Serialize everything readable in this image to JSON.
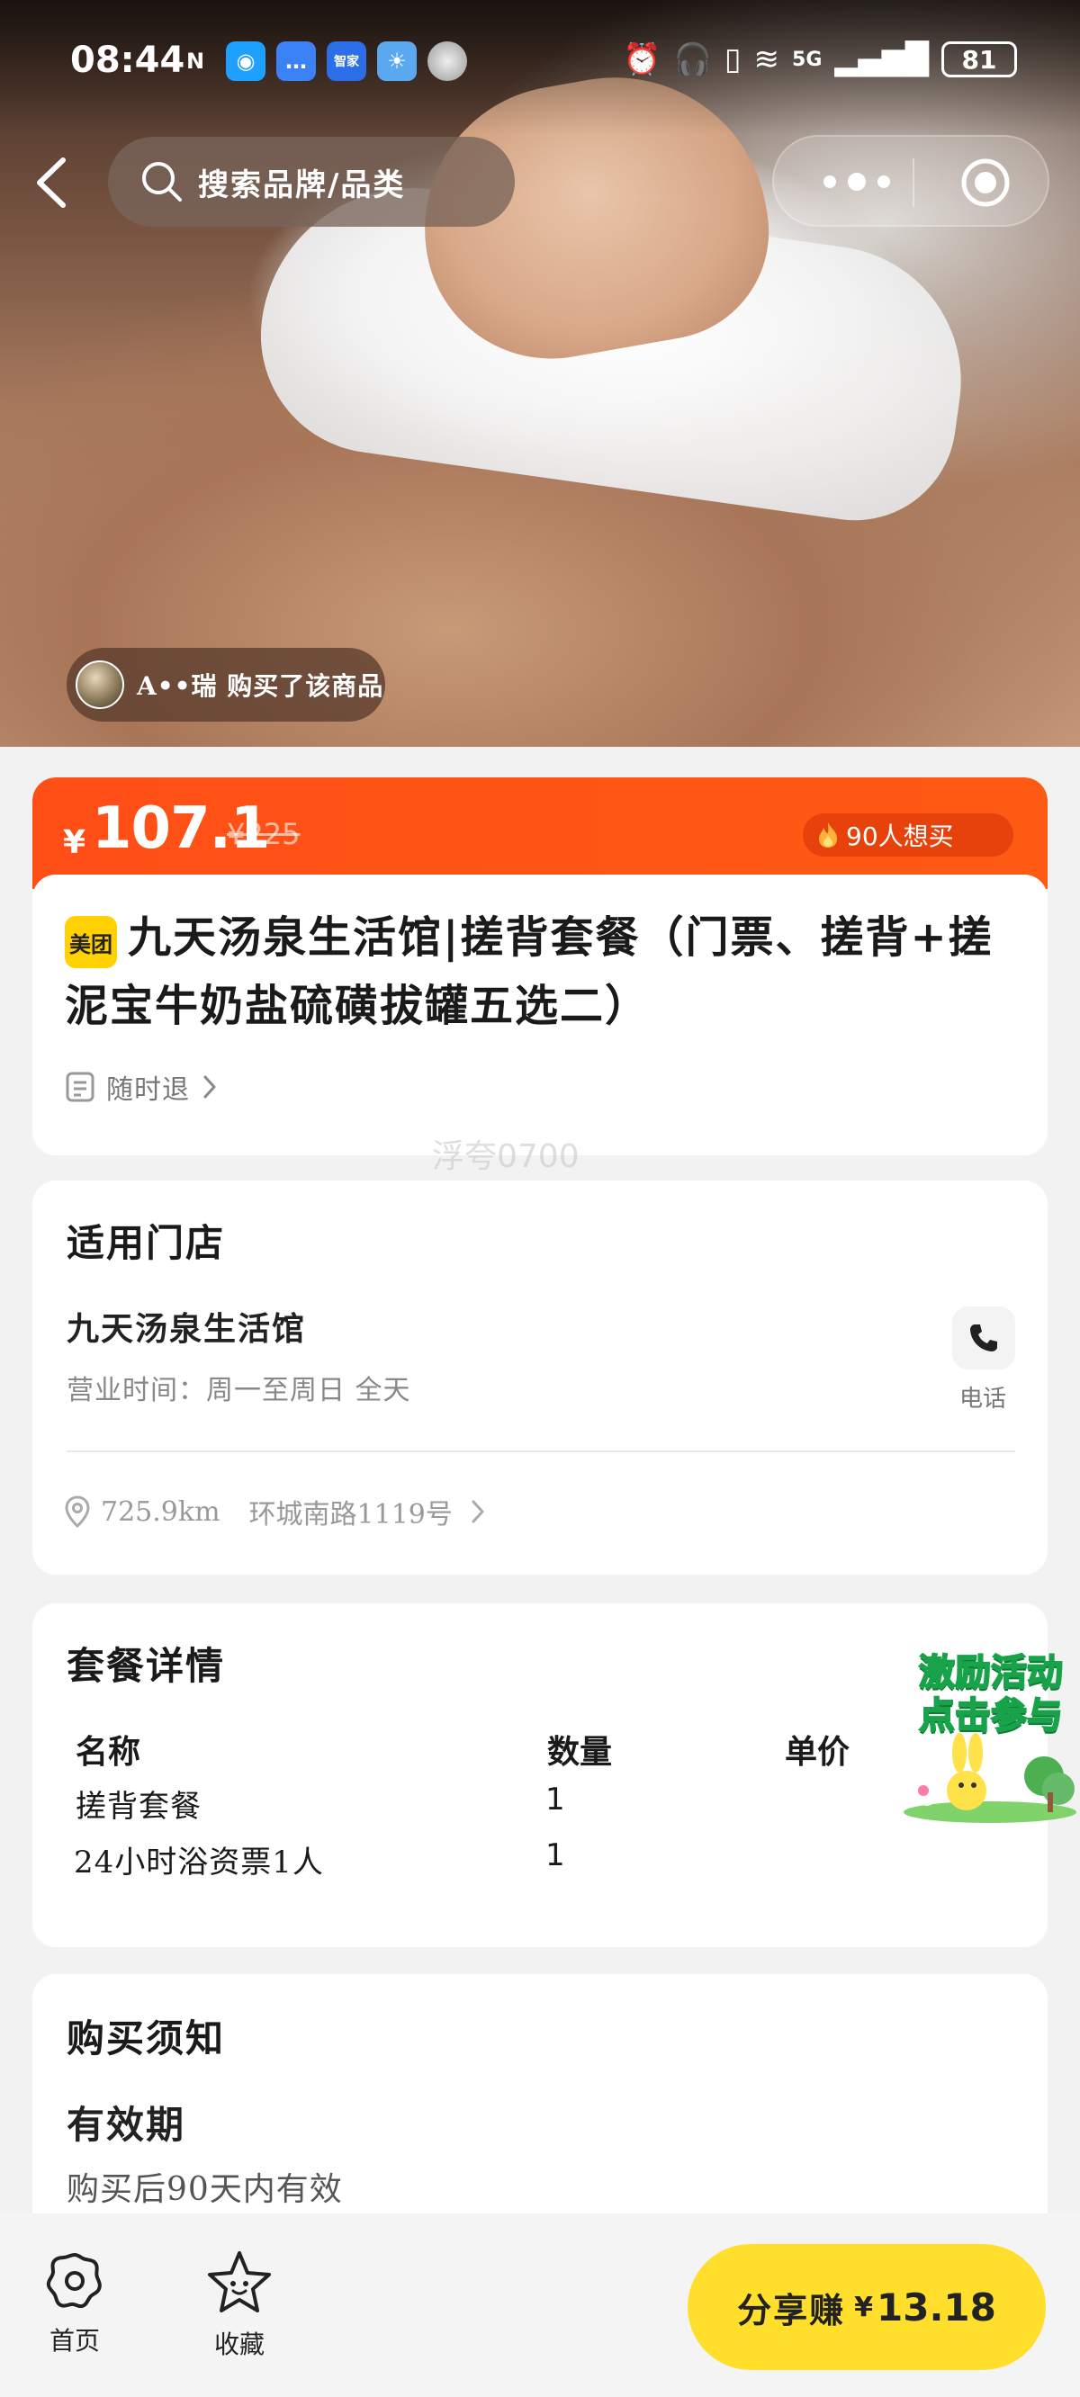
{
  "status_bar": {
    "time": "08:44",
    "network": "5G",
    "battery": "81"
  },
  "header": {
    "search_placeholder": "搜索品牌/品类"
  },
  "hero": {
    "buyer_notice": "A••瑞 购买了该商品"
  },
  "price": {
    "currency": "¥",
    "current": "107.1",
    "original": "¥225",
    "want_count": "90人想买"
  },
  "product": {
    "brand_badge": "美团",
    "title": "九天汤泉生活馆|搓背套餐（门票、搓背+搓泥宝牛奶盐硫磺拔罐五选二）",
    "refund_label": "随时退"
  },
  "watermark": "浮夸0700",
  "store": {
    "section_title": "适用门店",
    "name": "九天汤泉生活馆",
    "hours": "营业时间：周一至周日 全天",
    "phone_label": "电话",
    "distance": "725.9km",
    "address": "环城南路1119号"
  },
  "package": {
    "section_title": "套餐详情",
    "columns": [
      "名称",
      "数量",
      "单价"
    ],
    "rows": [
      {
        "name": "搓背套餐",
        "qty": "1",
        "price": ""
      },
      {
        "name": "24小时浴资票1人",
        "qty": "1",
        "price": ""
      }
    ]
  },
  "promo": {
    "line1": "激励活动",
    "line2": "点击参与"
  },
  "notice": {
    "section_title": "购买须知",
    "validity_title": "有效期",
    "validity_text": "购买后90天内有效"
  },
  "bottom_bar": {
    "home_label": "首页",
    "favorite_label": "收藏",
    "share_label": "分享赚",
    "share_currency": "¥",
    "share_amount": "13.18"
  },
  "colors": {
    "price_bar": "#ff4e16",
    "share_button": "#ffdf2b",
    "brand_badge": "#ffd100"
  }
}
